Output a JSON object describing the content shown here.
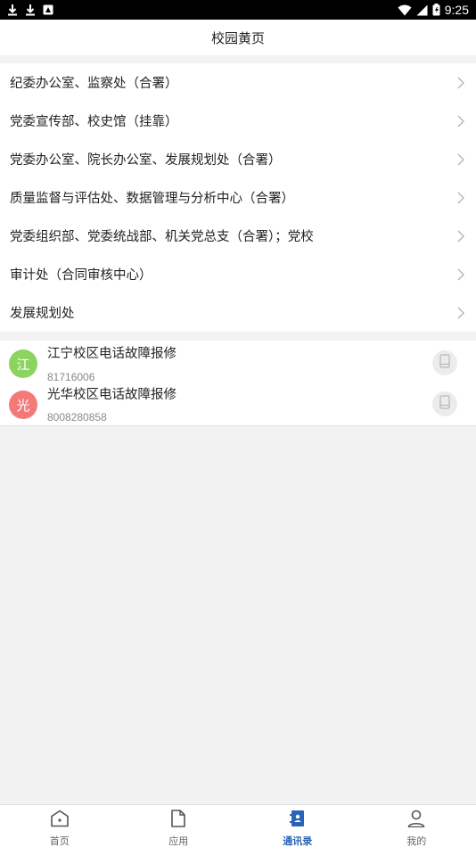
{
  "statusbar": {
    "time": "9:25",
    "left_icons": [
      "download-icon",
      "download-icon",
      "notification-icon"
    ],
    "right_icons": [
      "wifi-icon",
      "signal-icon",
      "battery-icon"
    ]
  },
  "header": {
    "title": "校园黄页"
  },
  "departments": [
    {
      "label": "纪委办公室、监察处（合署）"
    },
    {
      "label": "党委宣传部、校史馆（挂靠）"
    },
    {
      "label": "党委办公室、院长办公室、发展规划处（合署）"
    },
    {
      "label": "质量监督与评估处、数据管理与分析中心（合署）"
    },
    {
      "label": "党委组织部、党委统战部、机关党总支（合署）；党校"
    },
    {
      "label": "审计处（合同审核中心）"
    },
    {
      "label": "发展规划处"
    }
  ],
  "contacts": [
    {
      "avatar_text": "江",
      "avatar_color": "#8dd35f",
      "name": "江宁校区电话故障报修",
      "phone": "81716006"
    },
    {
      "avatar_text": "光",
      "avatar_color": "#f47a7a",
      "name": "光华校区电话故障报修",
      "phone": "8008280858"
    }
  ],
  "tabs": [
    {
      "label": "首页",
      "icon": "home-icon",
      "active": false
    },
    {
      "label": "应用",
      "icon": "document-icon",
      "active": false
    },
    {
      "label": "通讯录",
      "icon": "contacts-book-icon",
      "active": true
    },
    {
      "label": "我的",
      "icon": "user-icon",
      "active": false
    }
  ],
  "colors": {
    "accent": "#2a63b6",
    "background": "#f2f2f2"
  }
}
